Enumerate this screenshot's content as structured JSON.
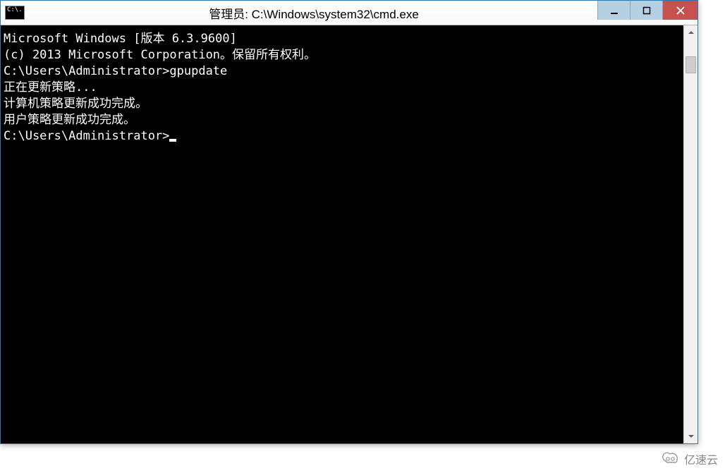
{
  "window": {
    "title": "管理员: C:\\Windows\\system32\\cmd.exe",
    "icon_text": "C:\\."
  },
  "terminal": {
    "lines": [
      "Microsoft Windows [版本 6.3.9600]",
      "(c) 2013 Microsoft Corporation。保留所有权利。",
      "",
      "C:\\Users\\Administrator>gpupdate",
      "正在更新策略...",
      "",
      "计算机策略更新成功完成。",
      "用户策略更新成功完成。",
      "",
      "",
      "C:\\Users\\Administrator>"
    ],
    "cursor_line_index": 10
  },
  "watermark": {
    "text": "亿速云"
  }
}
